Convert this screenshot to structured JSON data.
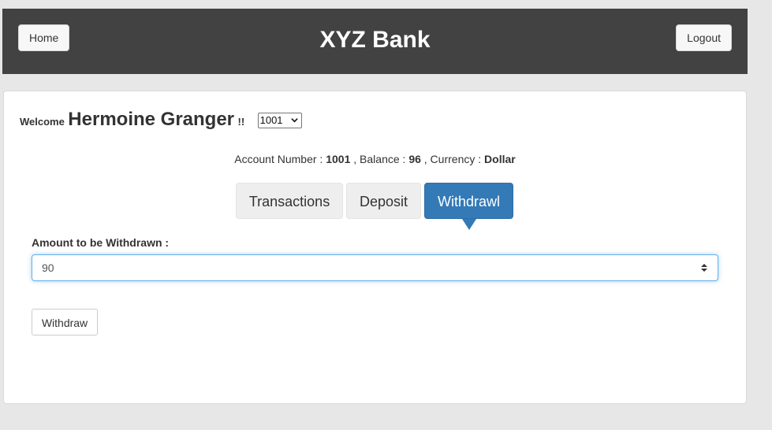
{
  "header": {
    "title": "XYZ Bank",
    "home_label": "Home",
    "logout_label": "Logout"
  },
  "customer": {
    "welcome_label": "Welcome",
    "name": "Hermoine Granger",
    "exclaim": "!!",
    "selected_account": "1001"
  },
  "account_info": {
    "account_number_label": "Account Number :",
    "account_number": "1001",
    "balance_label": ", Balance :",
    "balance": "96",
    "currency_label": ", Currency :",
    "currency": "Dollar"
  },
  "tabs": [
    {
      "label": "Transactions",
      "active": false
    },
    {
      "label": "Deposit",
      "active": false
    },
    {
      "label": "Withdrawl",
      "active": true
    }
  ],
  "withdraw_form": {
    "amount_label": "Amount to be Withdrawn :",
    "amount_value": "90",
    "submit_label": "Withdraw"
  },
  "colors": {
    "header_bg": "#424242",
    "active_tab": "#337ab7",
    "page_bg": "#e7e7e7"
  }
}
